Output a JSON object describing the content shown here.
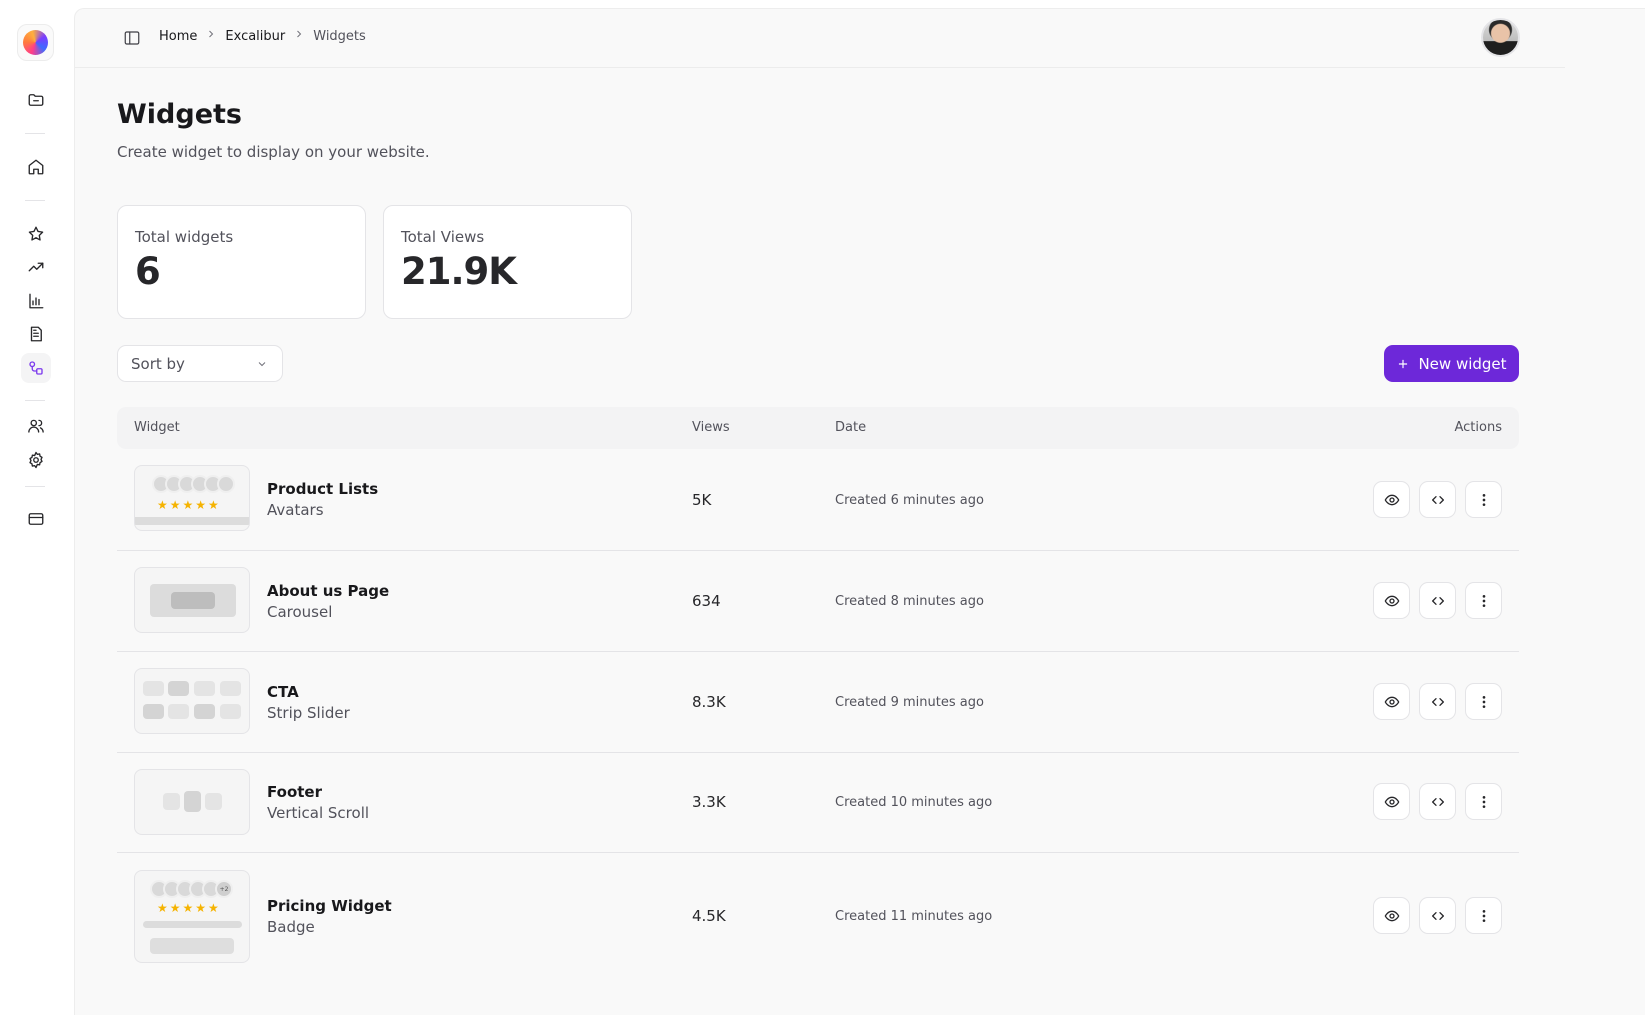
{
  "sidebar": {
    "items": [
      {
        "name": "folder-icon"
      },
      {
        "name": "home-icon"
      },
      {
        "name": "star-icon"
      },
      {
        "name": "trending-icon"
      },
      {
        "name": "bar-chart-icon"
      },
      {
        "name": "document-icon"
      },
      {
        "name": "widgets-icon",
        "active": true
      },
      {
        "name": "users-icon"
      },
      {
        "name": "settings-icon"
      },
      {
        "name": "credit-card-icon"
      }
    ]
  },
  "breadcrumb": {
    "items": [
      "Home",
      "Excalibur",
      "Widgets"
    ]
  },
  "page": {
    "title": "Widgets",
    "subtitle": "Create widget to display on your website."
  },
  "stats": {
    "total_widgets_label": "Total widgets",
    "total_widgets_value": "6",
    "total_views_label": "Total Views",
    "total_views_value": "21.9K"
  },
  "controls": {
    "sort_label": "Sort by",
    "new_widget_label": "New widget"
  },
  "table": {
    "headers": {
      "widget": "Widget",
      "views": "Views",
      "date": "Date",
      "actions": "Actions"
    },
    "rows": [
      {
        "name": "Product Lists",
        "type": "Avatars",
        "views": "5K",
        "date": "Created 6 minutes ago"
      },
      {
        "name": "About us Page",
        "type": "Carousel",
        "views": "634",
        "date": "Created 8 minutes ago"
      },
      {
        "name": "CTA",
        "type": "Strip Slider",
        "views": "8.3K",
        "date": "Created 9 minutes ago"
      },
      {
        "name": "Footer",
        "type": "Vertical Scroll",
        "views": "3.3K",
        "date": "Created 10 minutes ago"
      },
      {
        "name": "Pricing Widget",
        "type": "Badge",
        "views": "4.5K",
        "date": "Created 11 minutes ago"
      }
    ]
  },
  "thumbnails": {
    "stars": "★★★★★",
    "badge_count": "+2"
  },
  "colors": {
    "accent": "#6d28d9",
    "active_icon": "#7c3aed",
    "star": "#f5b301"
  }
}
